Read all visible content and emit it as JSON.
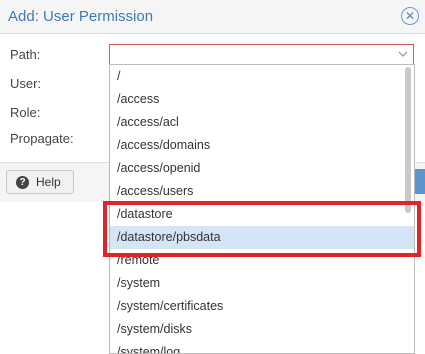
{
  "dialog": {
    "title": "Add: User Permission",
    "close_icon": "close-circle-icon"
  },
  "form": {
    "path_label": "Path:",
    "user_label": "User:",
    "role_label": "Role:",
    "propagate_label": "Propagate:",
    "path_value": ""
  },
  "footer": {
    "help_label": "Help",
    "help_icon": "question-circle-icon"
  },
  "path_options": [
    "/",
    "/access",
    "/access/acl",
    "/access/domains",
    "/access/openid",
    "/access/users",
    "/datastore",
    "/datastore/pbsdata",
    "/remote",
    "/system",
    "/system/certificates",
    "/system/disks",
    "/system/log"
  ],
  "selected_option": "/datastore/pbsdata",
  "colors": {
    "accent": "#3e7bb6",
    "invalid_border": "#cf5d55",
    "selected_row": "#d6e5f5",
    "annotation_box": "#e0242c"
  }
}
